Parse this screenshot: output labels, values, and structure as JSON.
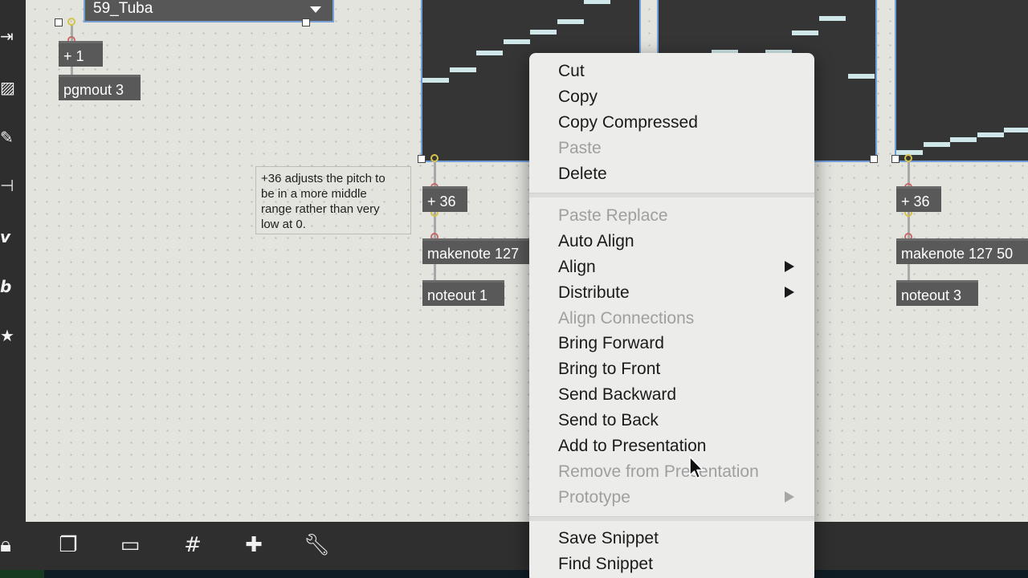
{
  "left_toolbar": {
    "icons": [
      "exit-icon",
      "image-icon",
      "paperclip-icon",
      "plug-icon",
      "vimeo-icon",
      "b-icon",
      "star-icon"
    ]
  },
  "patcher": {
    "umenu_value": "59_Tuba",
    "objects": {
      "plus1": "+ 1",
      "pgmout": "pgmout 3",
      "plus36_a": "+ 36",
      "makenote_a": "makenote 127",
      "noteout_a": "noteout 1",
      "plus36_b": "+ 36",
      "makenote_b": "makenote 127 50",
      "noteout_b": "noteout 3"
    },
    "comment_lines": [
      "+36 adjusts the pitch to",
      "be in a more middle",
      "range rather than very",
      "low at 0."
    ],
    "colors": {
      "canvas": "#e4e4df",
      "object": "#595959",
      "selection": "#6f9ddc",
      "slider_step": "#cfe7e9"
    }
  },
  "context_menu": {
    "items": [
      {
        "label": "Cut",
        "enabled": true
      },
      {
        "label": "Copy",
        "enabled": true
      },
      {
        "label": "Copy Compressed",
        "enabled": true
      },
      {
        "label": "Paste",
        "enabled": false
      },
      {
        "label": "Delete",
        "enabled": true
      },
      {
        "label": "Paste Replace",
        "enabled": false
      },
      {
        "label": "Auto Align",
        "enabled": true
      },
      {
        "label": "Align",
        "enabled": true,
        "submenu": true
      },
      {
        "label": "Distribute",
        "enabled": true,
        "submenu": true
      },
      {
        "label": "Align Connections",
        "enabled": false
      },
      {
        "label": "Bring Forward",
        "enabled": true
      },
      {
        "label": "Bring to Front",
        "enabled": true
      },
      {
        "label": "Send Backward",
        "enabled": true
      },
      {
        "label": "Send to Back",
        "enabled": true
      },
      {
        "label": "Add to Presentation",
        "enabled": true
      },
      {
        "label": "Remove from Presentation",
        "enabled": false
      },
      {
        "label": "Prototype",
        "enabled": false,
        "submenu": true
      },
      {
        "label": "Save Snippet",
        "enabled": true
      },
      {
        "label": "Find Snippet",
        "enabled": true
      }
    ]
  },
  "bottom_toolbar": {
    "icons": [
      "lock-icon",
      "windows-icon",
      "presentation-icon",
      "grid-icon",
      "add-clip-icon",
      "wrench-icon"
    ]
  }
}
